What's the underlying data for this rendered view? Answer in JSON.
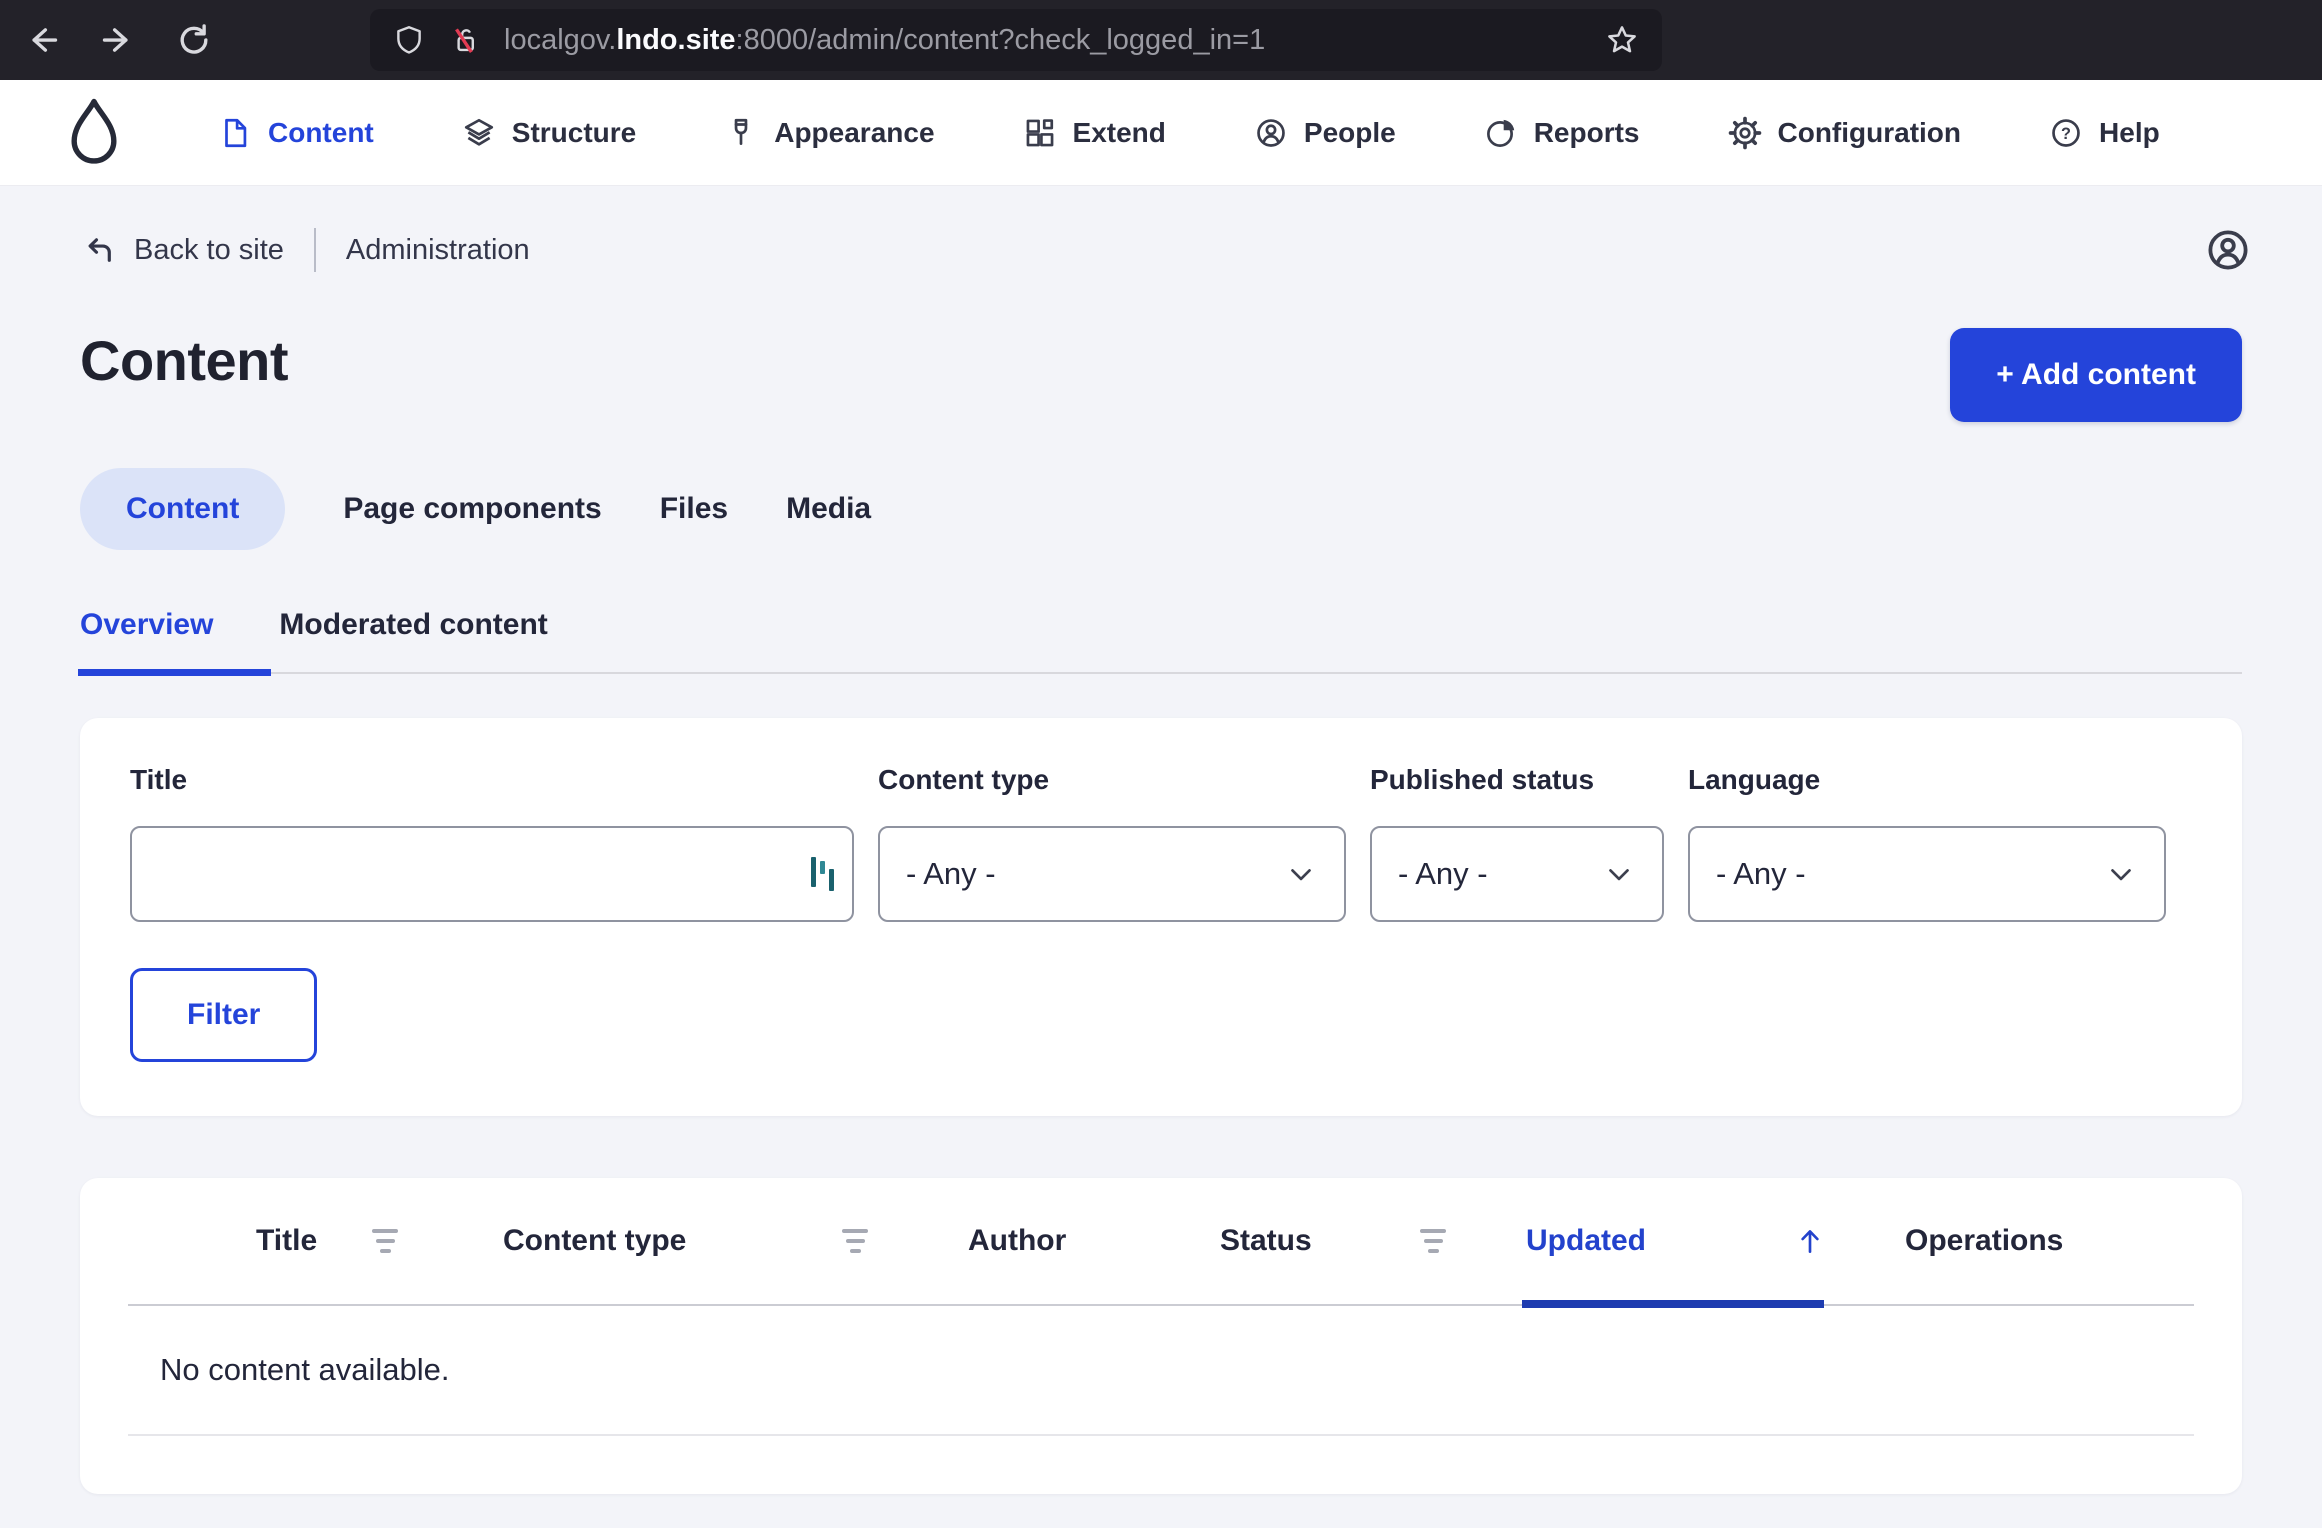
{
  "browser": {
    "url_prefix": "localgov.",
    "url_domain": "lndo.site",
    "url_suffix": ":8000/admin/content?check_logged_in=1"
  },
  "admin_toolbar": {
    "items": [
      {
        "label": "Content",
        "icon": "file-icon",
        "active": true
      },
      {
        "label": "Structure",
        "icon": "layers-icon"
      },
      {
        "label": "Appearance",
        "icon": "paintbrush-icon"
      },
      {
        "label": "Extend",
        "icon": "blocks-icon"
      },
      {
        "label": "People",
        "icon": "person-circle-icon"
      },
      {
        "label": "Reports",
        "icon": "pie-chart-icon"
      },
      {
        "label": "Configuration",
        "icon": "gear-icon"
      },
      {
        "label": "Help",
        "icon": "question-circle-icon"
      }
    ]
  },
  "breadcrumb": {
    "back_to_site": "Back to site",
    "section": "Administration"
  },
  "page": {
    "title": "Content",
    "add_content_button": "+ Add content"
  },
  "primary_tabs": [
    {
      "label": "Content",
      "active": true
    },
    {
      "label": "Page components"
    },
    {
      "label": "Files"
    },
    {
      "label": "Media"
    }
  ],
  "secondary_tabs": [
    {
      "label": "Overview",
      "active": true
    },
    {
      "label": "Moderated content"
    }
  ],
  "filters": {
    "fields": [
      {
        "label": "Title",
        "type": "text",
        "value": ""
      },
      {
        "label": "Content type",
        "value": "- Any -"
      },
      {
        "label": "Published status",
        "value": "- Any -"
      },
      {
        "label": "Language",
        "value": "- Any -"
      }
    ],
    "submit_label": "Filter"
  },
  "content_table": {
    "headers": [
      "Title",
      "Content type",
      "Author",
      "Status",
      "Updated",
      "Operations"
    ],
    "sorted_by": "Updated",
    "sort_direction": "ascending",
    "empty_message": "No content available."
  },
  "colors": {
    "accent": "#2444da",
    "active_pill_bg": "#dbe3f8",
    "sorted_underline": "#1e3cb0",
    "page_bg": "#f3f4f9",
    "chrome_bg": "#232229",
    "urlbar_bg": "#1b1a21",
    "broken_lock_slash": "#e23b53",
    "password_icon_teal": "#1a616d"
  }
}
